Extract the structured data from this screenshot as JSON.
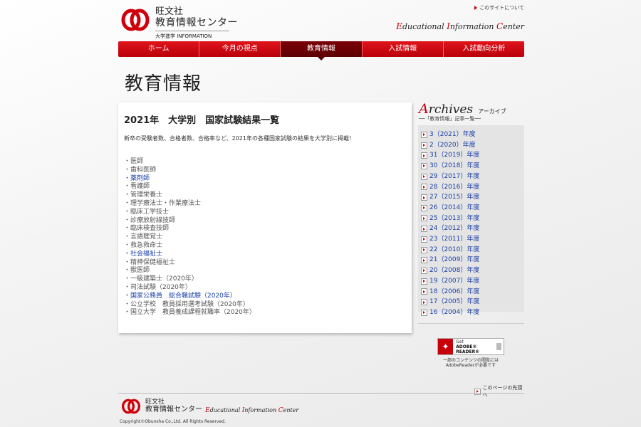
{
  "header": {
    "logo_title": "旺文社",
    "logo_subtitle": "教育情報センター",
    "logo_small": "大学進学 INFORMATION",
    "about_link": "このサイトについて",
    "eic_e": "E",
    "eic_rest1": "ducational ",
    "eic_i": "I",
    "eic_rest2": "nformation ",
    "eic_c": "C",
    "eic_rest3": "enter"
  },
  "nav": {
    "items": [
      {
        "label": "ホーム"
      },
      {
        "label": "今月の視点"
      },
      {
        "label": "教育情報"
      },
      {
        "label": "入試情報"
      },
      {
        "label": "入試動向分析"
      }
    ]
  },
  "page_title": "教育情報",
  "main": {
    "heading": "2021年　大学別　国家試験結果一覧",
    "description": "新卒の受験者数、合格者数、合格率など、2021年の各種国家試験の結果を大学別に掲載！",
    "items": [
      {
        "label": "・医師",
        "link": false
      },
      {
        "label": "・歯科医師",
        "link": false
      },
      {
        "label": "・薬剤師",
        "link": true
      },
      {
        "label": "・看護師",
        "link": false
      },
      {
        "label": "・管理栄養士",
        "link": false
      },
      {
        "label": "・理学療法士・作業療法士",
        "link": false
      },
      {
        "label": "・臨床工学技士",
        "link": false
      },
      {
        "label": "・診療放射線技師",
        "link": false
      },
      {
        "label": "・臨床検査技師",
        "link": false
      },
      {
        "label": "・言語聴覚士",
        "link": false
      },
      {
        "label": "・救急救命士",
        "link": false
      },
      {
        "label": "・社会福祉士",
        "link": true
      },
      {
        "label": "・精神保健福祉士",
        "link": false
      },
      {
        "label": "・獣医師",
        "link": false
      },
      {
        "label": "・一級建築士（2020年）",
        "link": false
      },
      {
        "label": "・司法試験（2020年）",
        "link": false
      },
      {
        "label": "・国家公務員　総合職試験（2020年）",
        "link": true
      },
      {
        "label": "・公立学校　教員採用選考試験（2020年）",
        "link": false
      },
      {
        "label": "・国立大学　教員養成課程就職率（2020年）",
        "link": false
      }
    ]
  },
  "archives": {
    "title_cap": "A",
    "title_rest": "rchives",
    "title_jp": "アーカイブ",
    "subtitle": "──「教育情報」記事一覧──",
    "years": [
      "3（2021）年度",
      "2（2020）年度",
      "31（2019）年度",
      "30（2018）年度",
      "29（2017）年度",
      "28（2016）年度",
      "27（2015）年度",
      "26（2014）年度",
      "25（2013）年度",
      "24（2012）年度",
      "23（2011）年度",
      "22（2010）年度",
      "21（2009）年度",
      "20（2008）年度",
      "19（2007）年度",
      "18（2006）年度",
      "17（2005）年度",
      "16（2004）年度"
    ]
  },
  "adobe": {
    "get": "Get",
    "name": "ADOBE® READER®",
    "note_line1": "一部のコンテンツの閲覧には",
    "note_line2": "AdobeReaderが必要です"
  },
  "footer": {
    "pagetop": "このページの先頭へ",
    "logo_title": "旺文社",
    "logo_subtitle": "教育情報センター",
    "copyright": "Copyright©Obunsha Co.,Ltd. All Rights Reserved."
  },
  "colors": {
    "accent": "#c8000a",
    "link": "#1a3fa8"
  }
}
